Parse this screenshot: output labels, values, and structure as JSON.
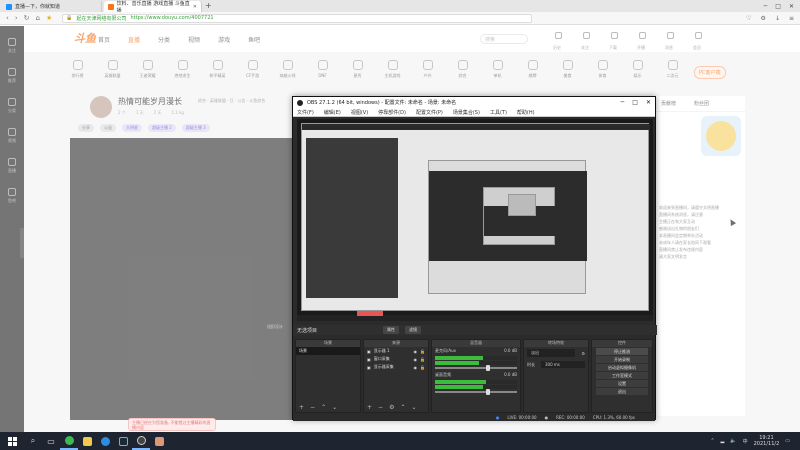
{
  "browser": {
    "tabs": [
      {
        "title": "直播—下，你就知道",
        "active": false
      },
      {
        "title": "饮料、音乐直播 游戏直播 斗鱼直播",
        "active": true
      }
    ],
    "new_tab": "+",
    "window_controls": [
      "─",
      "□",
      "✕"
    ],
    "url_secure_label": "起在天津网络有限公司",
    "url": "https://www.douyu.com/4007721"
  },
  "site": {
    "logo": "斗鱼",
    "nav": [
      {
        "label": "首页",
        "active": false
      },
      {
        "label": "直播",
        "active": true
      },
      {
        "label": "分类",
        "active": false
      },
      {
        "label": "视频",
        "active": false
      },
      {
        "label": "游戏",
        "active": false
      },
      {
        "label": "鱼吧",
        "active": false
      }
    ],
    "search_placeholder": "搜索",
    "header_icons": [
      "历史",
      "关注",
      "下载",
      "开播",
      "消息",
      "会员"
    ],
    "categories": [
      "排行榜",
      "英雄联盟",
      "王者荣耀",
      "绝地求生",
      "和平精英",
      "CF手游",
      "穿越火线",
      "DNF",
      "星秀",
      "主机游戏",
      "户外",
      "综合",
      "单机",
      "棋牌",
      "美食",
      "体育",
      "娱乐",
      "二次元",
      "颜值",
      "更多"
    ],
    "pc_client_button": "PC客户端",
    "rail": [
      "关注",
      "推荐",
      "分类",
      "视频",
      "直播",
      "鱼吧"
    ]
  },
  "room": {
    "title": "热情可能岁月漫长",
    "meta": "综合 · 英雄联盟 · 日 · 公告 · 斗鱼综合",
    "stats": [
      "2 个",
      "1 天",
      "2 天",
      "1.1 kg"
    ],
    "tags": [
      "分享",
      "公益",
      "大明星"
    ],
    "badges": [
      "超级主播 2",
      "超级主播 3"
    ],
    "player_label": "组织设计",
    "popup_text": "主播已经在为您准备, 不能错过主播精彩的直播内容"
  },
  "right_panel": {
    "tabs": [
      "贡献榜",
      "粉丝团"
    ],
    "rank_title": "前十排行",
    "chat": [
      "欢迎来到直播间，请遵守文明直播",
      "直播间系统消息，请注意",
      "主播正在和大家互动",
      "感谢送出礼物的朋友们",
      "本直播间会定期举办活动",
      "未成年人请在家长陪同下观看",
      "直播间禁止发布违规内容",
      "请大家文明发言"
    ]
  },
  "obs": {
    "title": "OBS 27.1.2 (64 bit, windows) - 配置文件: 未命名 - 场景: 未命名",
    "menu": [
      "文件(F)",
      "编辑(E)",
      "视图(V)",
      "停靠部件(D)",
      "配置文件(P)",
      "场景集合(S)",
      "工具(T)",
      "帮助(H)"
    ],
    "scene_bar_label": "无选项目",
    "scene_bar_buttons": [
      "属性",
      "滤镜"
    ],
    "docks": {
      "scenes": {
        "header": "场景",
        "items": [
          "场景"
        ]
      },
      "sources": {
        "header": "来源",
        "items": [
          "显示器 1",
          "窗口采集",
          "显示器采集"
        ]
      },
      "mixer": {
        "header": "混音器",
        "channels": [
          {
            "name": "麦克风/Aux",
            "db": "0.0 dB",
            "level": 0.58
          },
          {
            "name": "桌面音频",
            "db": "0.0 dB",
            "level": 0.62
          }
        ]
      },
      "transitions": {
        "header": "转场特效",
        "type": "淡出",
        "duration_label": "时长",
        "duration": "300 ms"
      },
      "controls": {
        "header": "控件",
        "buttons": [
          "停止推流",
          "开始录制",
          "启动虚拟摄像机",
          "工作室模式",
          "设置",
          "退出"
        ]
      }
    },
    "status": [
      "LIVE: 00:00:00",
      "REC: 00:00:00",
      "CPU: 1.3%, 60.00 fps"
    ]
  },
  "taskbar": {
    "apps": [
      "search",
      "task-view",
      "chrome",
      "folder",
      "edge",
      "steam",
      "obs",
      "obs2"
    ],
    "time": "19:21",
    "date": "2021/11/2"
  }
}
